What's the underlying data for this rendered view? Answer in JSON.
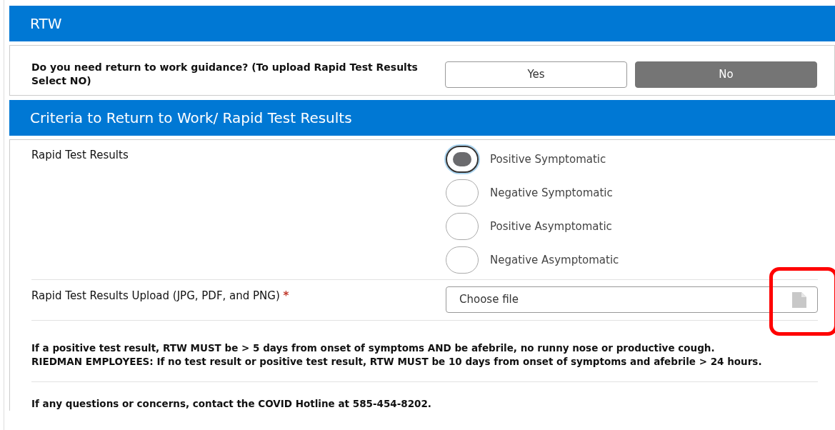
{
  "sections": [
    {
      "title": "RTW"
    },
    {
      "title": "Criteria to Return to Work/ Rapid Test Results"
    }
  ],
  "guidance": {
    "question": "Do you need return to work guidance? (To upload Rapid Test Results Select NO)",
    "options": [
      {
        "label": "Yes",
        "selected": false
      },
      {
        "label": "No",
        "selected": true
      }
    ]
  },
  "rapid_test": {
    "label": "Rapid Test Results",
    "options": [
      {
        "label": "Positive Symptomatic",
        "selected": true
      },
      {
        "label": "Negative Symptomatic",
        "selected": false
      },
      {
        "label": "Positive Asymptomatic",
        "selected": false
      },
      {
        "label": "Negative Asymptomatic",
        "selected": false
      }
    ]
  },
  "upload": {
    "label": "Rapid Test Results Upload (JPG, PDF, and PNG)",
    "required_mark": "*",
    "placeholder": "Choose file",
    "highlighted": true
  },
  "notes": [
    "If a positive test result, RTW MUST be > 5 days from onset of symptoms AND be afebrile, no runny nose or productive cough.",
    "RIEDMAN EMPLOYEES: If no test result or positive test result, RTW MUST be 10 days from onset of symptoms and afebrile > 24 hours.",
    "If any questions or concerns, contact the COVID Hotline at 585-454-8202."
  ]
}
